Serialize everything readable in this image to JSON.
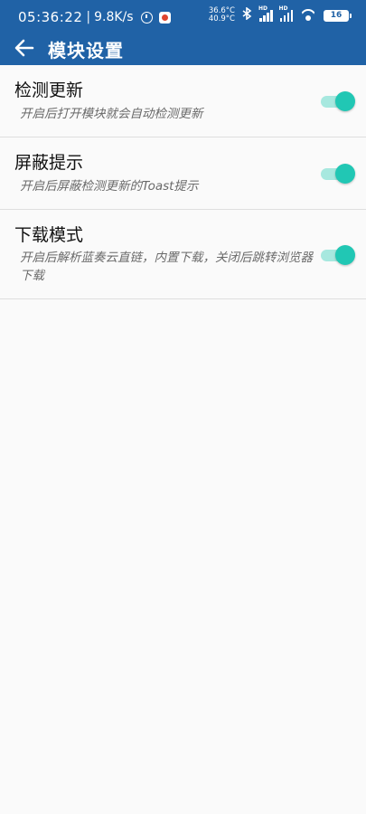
{
  "status_bar": {
    "time": "05:36:22",
    "separator": "|",
    "net_speed": "9.8K/s",
    "temp_1": "36.6°C",
    "temp_2": "40.9°C",
    "signal_1_label": "HD",
    "signal_2_label": "HD",
    "battery_level": "16",
    "icons": [
      "alarm-icon",
      "app-notification-icon",
      "bluetooth-icon",
      "signal-icon",
      "wifi-icon",
      "battery-icon"
    ]
  },
  "app_bar": {
    "back_icon": "arrow-left-icon",
    "title": "模块设置",
    "background": "#2062a6"
  },
  "settings": [
    {
      "title": "检测更新",
      "description": "开启后打开模块就会自动检测更新",
      "enabled": true
    },
    {
      "title": "屏蔽提示",
      "description": "开启后屏蔽检测更新的Toast提示",
      "enabled": true
    },
    {
      "title": "下载模式",
      "description": "开启后解析蓝奏云直链，内置下载，关闭后跳转浏览器下载",
      "enabled": true
    }
  ],
  "colors": {
    "switch_on_thumb": "#21c7b4",
    "switch_on_track": "#a7e8df",
    "background": "#fafafa"
  }
}
